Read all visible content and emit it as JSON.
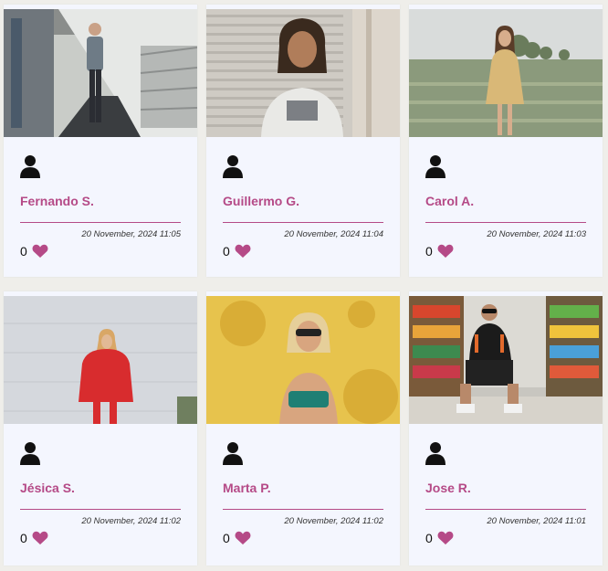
{
  "colors": {
    "accent": "#b54a87",
    "card_bg": "#f4f6fe",
    "page_bg": "#efeeea"
  },
  "posts": [
    {
      "name": "Fernando S.",
      "date": "20 November, 2024 11:05",
      "likes": "0",
      "photo": "man-walking-covered-walkway"
    },
    {
      "name": "Guillermo G.",
      "date": "20 November, 2024 11:04",
      "likes": "0",
      "photo": "man-dreadlocks-shutter"
    },
    {
      "name": "Carol A.",
      "date": "20 November, 2024 11:03",
      "likes": "0",
      "photo": "woman-yellow-dress-field"
    },
    {
      "name": "Jésica S.",
      "date": "20 November, 2024 11:02",
      "likes": "0",
      "photo": "woman-red-sweater-white-wall"
    },
    {
      "name": "Marta P.",
      "date": "20 November, 2024 11:02",
      "likes": "0",
      "photo": "woman-sunglasses-yellow-wall"
    },
    {
      "name": "Jose R.",
      "date": "20 November, 2024 11:01",
      "likes": "0",
      "photo": "man-crouching-supermarket-aisle"
    }
  ]
}
